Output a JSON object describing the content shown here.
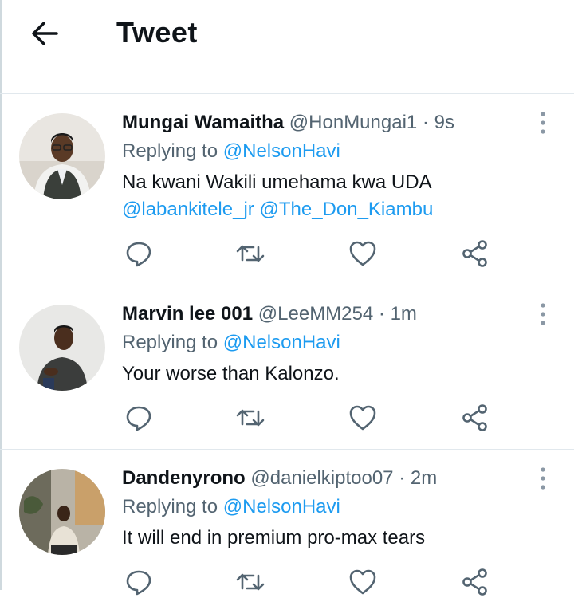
{
  "header": {
    "title": "Tweet"
  },
  "tweets": [
    {
      "name": "Mungai Wamaitha",
      "handle": "@HonMungai1",
      "time": "9s",
      "replying_prefix": "Replying to",
      "replying_to": "@NelsonHavi",
      "text": "Na kwani Wakili umehama kwa  UDA",
      "mentions": [
        "@labankitele_jr",
        "@The_Don_Kiambu"
      ]
    },
    {
      "name": "Marvin lee 001",
      "handle": "@LeeMM254",
      "time": "1m",
      "replying_prefix": "Replying to",
      "replying_to": "@NelsonHavi",
      "text": "Your worse than Kalonzo."
    },
    {
      "name": "Dandenyrono",
      "handle": "@danielkiptoo07",
      "time": "2m",
      "replying_prefix": "Replying to",
      "replying_to": "@NelsonHavi",
      "text": "It will end in premium pro-max tears"
    }
  ],
  "icons": {
    "back": "back-arrow-icon",
    "more": "more-vertical-icon",
    "reply": "reply-icon",
    "retweet": "retweet-icon",
    "like": "heart-icon",
    "share": "share-icon"
  },
  "colors": {
    "link": "#1d9bf0",
    "secondary_text": "#536471",
    "icon": "#536471",
    "divider": "#e1e8ed"
  }
}
